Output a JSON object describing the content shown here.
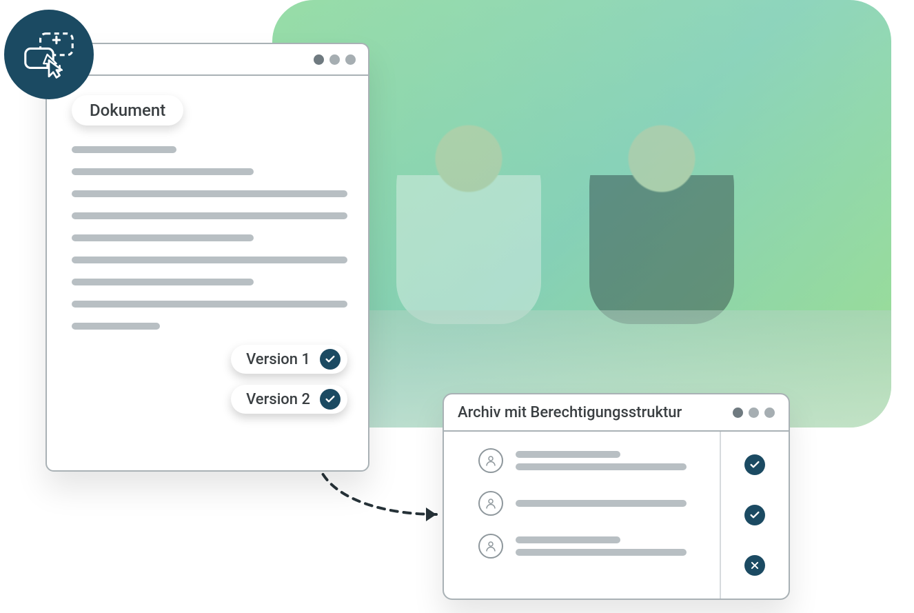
{
  "colors": {
    "brand": "#1b4a62",
    "overlay": "#6fd08c",
    "line": "#b8bfc3"
  },
  "document_window": {
    "tag": "Dokument",
    "versions": [
      {
        "label": "Version 1",
        "status": "check"
      },
      {
        "label": "Version 2",
        "status": "check"
      }
    ]
  },
  "archive_window": {
    "title": "Archiv mit Berechtigungsstruktur",
    "rows": [
      {
        "status": "check"
      },
      {
        "status": "check"
      },
      {
        "status": "deny"
      }
    ]
  }
}
